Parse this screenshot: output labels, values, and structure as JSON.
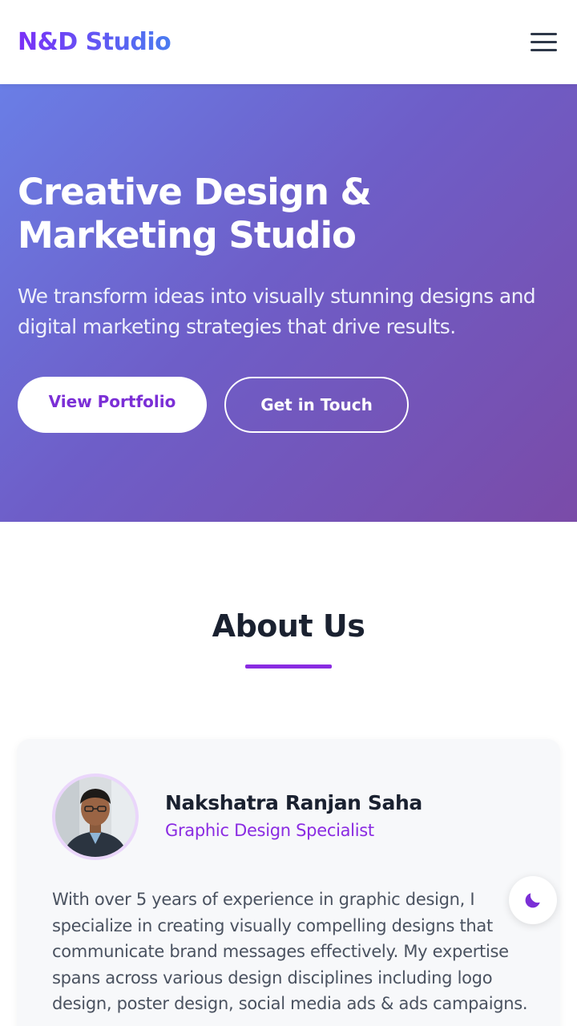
{
  "header": {
    "logo": "N&D Studio"
  },
  "hero": {
    "title": "Creative Design & Marketing Studio",
    "subtitle": "We transform ideas into visually stunning designs and digital marketing strategies that drive results.",
    "primary_button": "View Portfolio",
    "secondary_button": "Get in Touch"
  },
  "about": {
    "title": "About Us",
    "person": {
      "name": "Nakshatra Ranjan Saha",
      "role": "Graphic Design Specialist",
      "bio": "With over 5 years of experience in graphic design, I specialize in creating visually compelling designs that communicate brand messages effectively. My expertise spans across various design disciplines including logo design, poster design, social media ads & ads campaigns."
    }
  },
  "icons": {
    "menu": "hamburger-menu-icon",
    "theme": "moon-icon"
  },
  "colors": {
    "brand_purple": "#8a2be2",
    "brand_blue": "#4a7cf0",
    "hero_gradient_start": "#6a7ee6",
    "hero_gradient_end": "#7a4ba8"
  }
}
